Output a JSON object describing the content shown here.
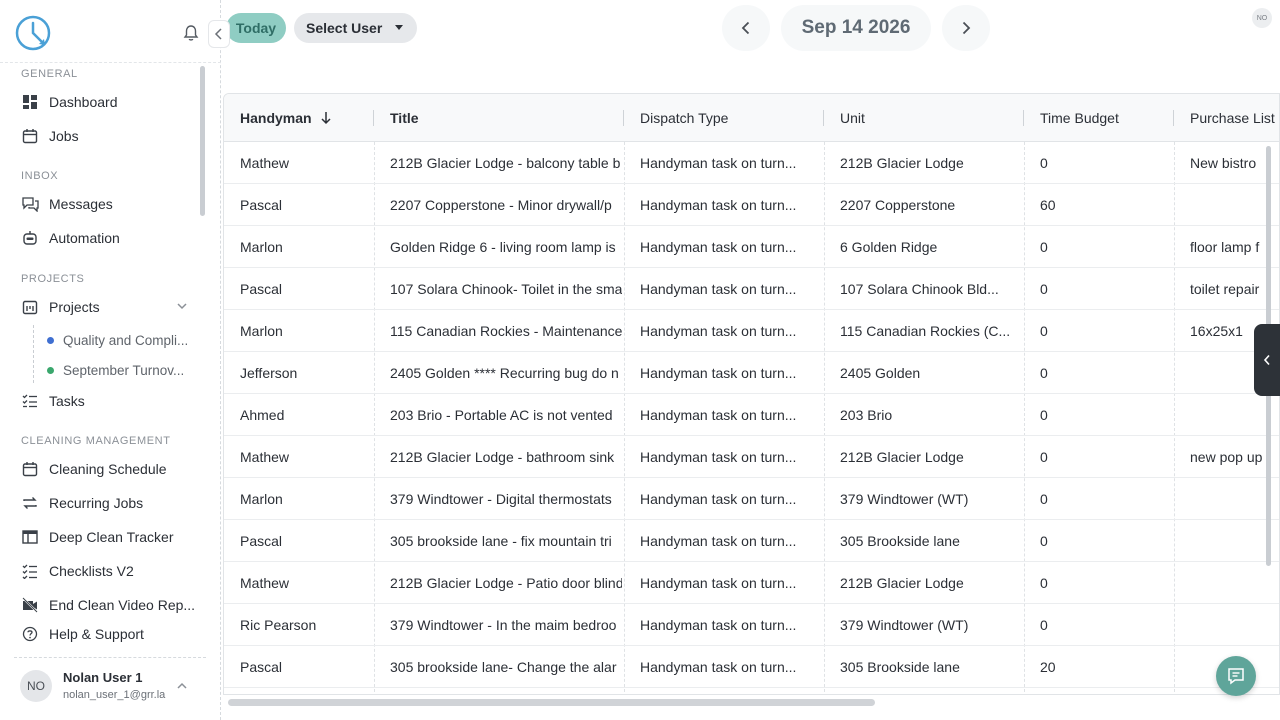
{
  "sidebar": {
    "sections": [
      {
        "title": "GENERAL"
      },
      {
        "title": "INBOX"
      },
      {
        "title": "PROJECTS"
      },
      {
        "title": "CLEANING MANAGEMENT"
      }
    ],
    "items": {
      "dashboard": "Dashboard",
      "jobs": "Jobs",
      "messages": "Messages",
      "automation": "Automation",
      "projects": "Projects",
      "project_sub1": "Quality and Compli...",
      "project_sub2": "September Turnov...",
      "tasks": "Tasks",
      "cleaning_schedule": "Cleaning Schedule",
      "recurring_jobs": "Recurring Jobs",
      "deep_clean_tracker": "Deep Clean Tracker",
      "checklists_v2": "Checklists V2",
      "end_clean_video": "End Clean Video Rep...",
      "help_support": "Help & Support"
    },
    "sub_colors": {
      "project_sub1": "#3f6fd1",
      "project_sub2": "#3aa76d"
    },
    "user": {
      "initials": "NO",
      "name": "Nolan User 1",
      "email": "nolan_user_1@grr.la"
    }
  },
  "topbar": {
    "today_label": "Today",
    "select_user_label": "Select User",
    "date_label": "Sep 14 2026",
    "avatar_initials": "NO"
  },
  "colors": {
    "accent": "#8fcdc3",
    "accent_text": "#2f6e66",
    "chat": "#5fa59a",
    "logo": "#4aa0d6"
  },
  "table": {
    "columns": [
      "Handyman",
      "Title",
      "Dispatch Type",
      "Unit",
      "Time Budget",
      "Purchase List"
    ],
    "sorted_column": "Handyman",
    "rows": [
      [
        "Mathew",
        "212B Glacier Lodge - balcony table b",
        "Handyman task on turn...",
        "212B Glacier Lodge",
        "0",
        "New bistro"
      ],
      [
        "Pascal",
        "2207 Copperstone - Minor drywall/p",
        "Handyman task on turn...",
        "2207 Copperstone",
        "60",
        ""
      ],
      [
        "Marlon",
        "Golden Ridge 6 - living room lamp is",
        "Handyman task on turn...",
        "6 Golden Ridge",
        "0",
        "floor lamp f"
      ],
      [
        "Pascal",
        "107 Solara Chinook- Toilet in the sma",
        "Handyman task on turn...",
        "107 Solara Chinook Bld...",
        "0",
        "toilet repair"
      ],
      [
        "Marlon",
        "115 Canadian Rockies - Maintenance",
        "Handyman task on turn...",
        "115 Canadian Rockies (C...",
        "0",
        "16x25x1"
      ],
      [
        "Jefferson",
        "2405 Golden **** Recurring bug do n",
        "Handyman task on turn...",
        "2405 Golden",
        "0",
        ""
      ],
      [
        "Ahmed",
        "203 Brio - Portable AC is not vented",
        "Handyman task on turn...",
        "203 Brio",
        "0",
        ""
      ],
      [
        "Mathew",
        "212B Glacier Lodge - bathroom sink",
        "Handyman task on turn...",
        "212B Glacier Lodge",
        "0",
        "new pop up"
      ],
      [
        "Marlon",
        "379 Windtower - Digital thermostats",
        "Handyman task on turn...",
        "379 Windtower (WT)",
        "0",
        ""
      ],
      [
        "Pascal",
        "305 brookside lane - fix mountain tri",
        "Handyman task on turn...",
        "305 Brookside lane",
        "0",
        ""
      ],
      [
        "Mathew",
        "212B Glacier Lodge - Patio door blind",
        "Handyman task on turn...",
        "212B Glacier Lodge",
        "0",
        ""
      ],
      [
        "Ric Pearson",
        "379 Windtower - In the maim bedroo",
        "Handyman task on turn...",
        "379 Windtower (WT)",
        "0",
        ""
      ],
      [
        "Pascal",
        "305 brookside lane- Change the alar",
        "Handyman task on turn...",
        "305 Brookside lane",
        "20",
        ""
      ]
    ]
  }
}
